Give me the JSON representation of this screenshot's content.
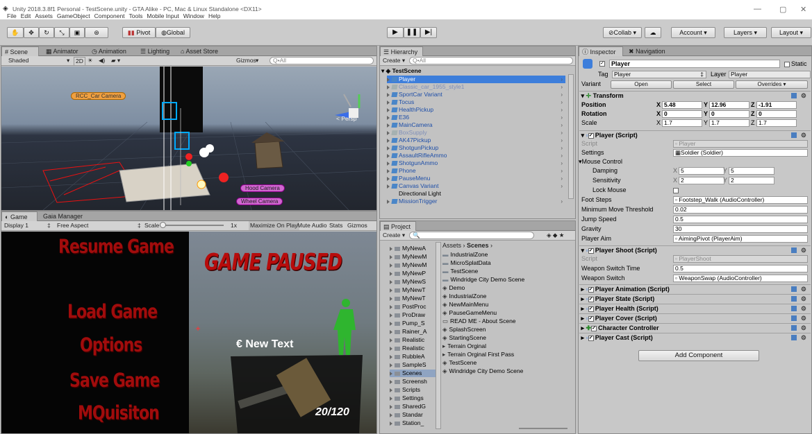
{
  "title_bar": {
    "title": "Unity 2018.3.8f1 Personal - TestScene.unity - GTA Alike - PC, Mac & Linux Standalone <DX11>"
  },
  "menu": [
    "File",
    "Edit",
    "Assets",
    "GameObject",
    "Component",
    "Tools",
    "Mobile Input",
    "Window",
    "Help"
  ],
  "toolbar": {
    "pivot": "Pivot",
    "global": "Global",
    "collab": "Collab",
    "account": "Account",
    "layers": "Layers",
    "layout": "Layout"
  },
  "scene_panel": {
    "tabs": [
      "Scene",
      "Animator",
      "Animation",
      "Lighting",
      "Asset Store"
    ],
    "shading": "Shaded",
    "mode_2d": "2D",
    "gizmos": "Gizmos",
    "search": "Q•All",
    "persp": "< Persp",
    "labels": [
      "RCC_Car Camera",
      "Hood Camera",
      "Wheel Camera"
    ]
  },
  "game_panel": {
    "tabs": [
      "Game",
      "Gaia Manager"
    ],
    "display": "Display 1",
    "aspect": "Free Aspect",
    "scale_label": "Scale",
    "scale_value": "1x",
    "options": [
      "Maximize On Play",
      "Mute Audio",
      "Stats",
      "Gizmos"
    ],
    "menu_items": [
      "Resume Game",
      "Load Game",
      "Options",
      "Save Game",
      "MQuisiton"
    ],
    "paused_title": "GAME PAUSED",
    "new_text": "€ New Text",
    "ammo": "20/120"
  },
  "hierarchy": {
    "tab": "Hierarchy",
    "create": "Create",
    "search": "Q•All",
    "scene": "TestScene",
    "items": [
      {
        "label": "Player",
        "selected": true,
        "faded": false
      },
      {
        "label": "Classic_car_1955_style1",
        "faded": true
      },
      {
        "label": "SportCar Variant",
        "faded": false
      },
      {
        "label": "Tocus",
        "faded": false
      },
      {
        "label": "HealthPickup",
        "faded": false
      },
      {
        "label": "E36",
        "faded": false
      },
      {
        "label": "MainCamera",
        "faded": false
      },
      {
        "label": "BoxSupply",
        "faded": true
      },
      {
        "label": "AK47Pickup",
        "faded": false
      },
      {
        "label": "ShotgunPickup",
        "faded": false
      },
      {
        "label": "AssaultRifleAmmo",
        "faded": false
      },
      {
        "label": "ShotgunAmmo",
        "faded": false
      },
      {
        "label": "Phone",
        "faded": false
      },
      {
        "label": "PauseMenu",
        "faded": false
      },
      {
        "label": "Canvas Variant",
        "faded": false
      },
      {
        "label": "Directional Light",
        "faded": false,
        "plain": true
      },
      {
        "label": "MissionTrigger",
        "faded": false
      }
    ]
  },
  "project": {
    "tab": "Project",
    "create": "Create",
    "breadcrumb_root": "Assets",
    "breadcrumb_current": "Scenes",
    "tree": [
      "MyNewA",
      "MyNewM",
      "MyNewM",
      "MyNewP",
      "MyNewS",
      "MyNewT",
      "MyNewT",
      "PostProc",
      "ProDraw",
      "Pump_S",
      "Rainer_A",
      "Realistic",
      "Realistic",
      "RubbleA",
      "SampleS",
      "Scenes",
      "Screensh",
      "Scripts",
      "Settings",
      "SharedG",
      "Standar",
      "Station_"
    ],
    "files": [
      {
        "label": "IndustrialZone",
        "icon": "folder"
      },
      {
        "label": "MicroSplatData",
        "icon": "folder"
      },
      {
        "label": "TestScene",
        "icon": "folder"
      },
      {
        "label": "Windridge City Demo Scene",
        "icon": "folder"
      },
      {
        "label": "Demo",
        "icon": "unity"
      },
      {
        "label": "IndustrialZone",
        "icon": "unity"
      },
      {
        "label": "NewMainMenu",
        "icon": "unity"
      },
      {
        "label": "PauseGameMenu",
        "icon": "unity"
      },
      {
        "label": "READ ME - About Scene",
        "icon": "doc"
      },
      {
        "label": "SplashScreen",
        "icon": "unity"
      },
      {
        "label": "StartingScene",
        "icon": "unity"
      },
      {
        "label": "Terrain Orginal",
        "icon": "prefab"
      },
      {
        "label": "Terrain Orginal First Pass",
        "icon": "prefab"
      },
      {
        "label": "TestScene",
        "icon": "unity"
      },
      {
        "label": "Windridge City Demo Scene",
        "icon": "unity"
      }
    ]
  },
  "inspector": {
    "tabs": [
      "Inspector",
      "Navigation"
    ],
    "object_name": "Player",
    "static": "Static",
    "tag_label": "Tag",
    "tag_value": "Player",
    "layer_label": "Layer",
    "layer_value": "Player",
    "variant_label": "Variant",
    "variant_buttons": [
      "Open",
      "Select",
      "Overrides"
    ],
    "transform": {
      "title": "Transform",
      "position": {
        "label": "Position",
        "x": "5.48",
        "y": "12.96",
        "z": "-1.91"
      },
      "rotation": {
        "label": "Rotation",
        "x": "0",
        "y": "0",
        "z": "0"
      },
      "scale": {
        "label": "Scale",
        "x": "1.7",
        "y": "1.7",
        "z": "1.7"
      }
    },
    "player_script": {
      "title": "Player (Script)",
      "script_label": "Script",
      "script_value": "Player",
      "settings_label": "Settings",
      "settings_value": "Soldier (Soldier)",
      "mouse_control": "Mouse Control",
      "damping_label": "Damping",
      "damping_x": "5",
      "damping_y": "5",
      "sensitivity_label": "Sensitivity",
      "sensitivity_x": "2",
      "sensitivity_y": "2",
      "lock_mouse": "Lock Mouse",
      "foot_steps_label": "Foot Steps",
      "foot_steps_value": "Footstep_Walk (AudioController)",
      "min_move_label": "Minimum Move Threshold",
      "min_move_value": "0.02",
      "jump_label": "Jump Speed",
      "jump_value": "0.5",
      "gravity_label": "Gravity",
      "gravity_value": "30",
      "aim_label": "Player Aim",
      "aim_value": "AimingPivot (PlayerAim)"
    },
    "shoot_script": {
      "title": "Player Shoot (Script)",
      "script_label": "Script",
      "script_value": "PlayerShoot",
      "switch_time_label": "Weapon Switch Time",
      "switch_time_value": "0.5",
      "switch_label": "Weapon Switch",
      "switch_value": "WeaponSwap (AudioController)"
    },
    "components": [
      "Player Animation (Script)",
      "Player State (Script)",
      "Player Health (Script)",
      "Player Cover (Script)",
      "Character Controller",
      "Player Cast (Script)"
    ],
    "add_component": "Add Component"
  },
  "colors": {
    "accent_blue": "#3d7edb",
    "game_red": "#a10c0c",
    "scene_sky": "#8a9bb0"
  }
}
